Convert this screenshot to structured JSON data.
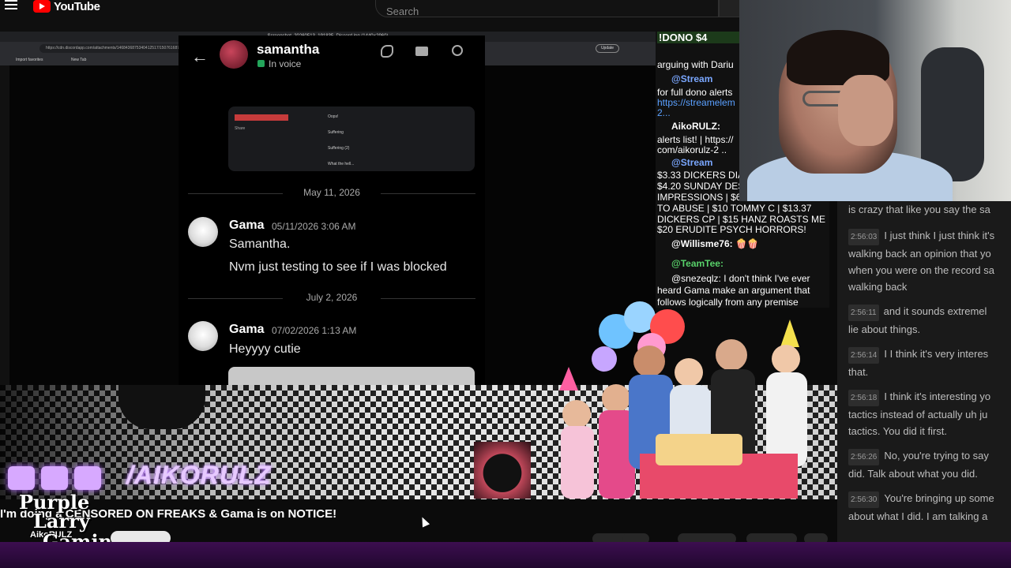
{
  "youtube": {
    "logo_text": "YouTube",
    "search_placeholder": "Search"
  },
  "browser": {
    "title": "Screenshot_20260513_191835_Discord.jpg (1440×2960)",
    "url": "https://cdn.discordapp.com/attachments/1468436875340412517/1507616871335855150/Screenshot_20260513_191835_Discord.jpg?ex=6a0e000b&is=6a0d0e8b&hm=a08d03939f93ddceeb",
    "update_label": "Update",
    "bookmarks": [
      "Import favorites",
      "New Tab"
    ]
  },
  "discord": {
    "contact_name": "samantha",
    "contact_status": "In voice",
    "embed": {
      "share_label": "Share",
      "rows": [
        "Oops!",
        "Suffering",
        "Suffering (2)",
        "What the hell..."
      ]
    },
    "dates": [
      "May 11, 2026",
      "July 2, 2026"
    ],
    "messages": [
      {
        "author": "Gama",
        "time": "05/11/2026 3:06 AM",
        "lines": [
          "Samantha.",
          "Nvm just testing to see if I was blocked"
        ]
      },
      {
        "author": "Gama",
        "time": "07/02/2026 1:13 AM",
        "lines": [
          "Heyyyy cutie"
        ]
      }
    ]
  },
  "overlay": {
    "handle": "/AIKORULZ",
    "stream_title": "I'm doing a CENSORED ON FREAKS & Gama is on NOTICE!",
    "brand": {
      "line1": "Purple",
      "line2": "Larry",
      "line3": "Gaming",
      "small": "AikoRULZ"
    },
    "subscribe_label": ""
  },
  "dono_chat": {
    "banner": "!DONO  $4",
    "lines": [
      {
        "text": "arguing with Dariu",
        "style": "plain"
      },
      {
        "text": "@Stream",
        "style": "blue"
      },
      {
        "text": "for full dono alerts",
        "style": "plain"
      },
      {
        "text": "https://streamelem",
        "style": "link"
      },
      {
        "text": "2...",
        "style": "link"
      },
      {
        "text": "AikoRULZ:",
        "style": "white"
      },
      {
        "text": "alerts list! | https://",
        "style": "plain"
      },
      {
        "text": "com/aikorulz-2 ..",
        "style": "plain"
      },
      {
        "text": "@Stream",
        "style": "blue"
      },
      {
        "text": "$3.33 DICKERS DIA",
        "style": "plain"
      },
      {
        "text": "$4.20 SUNDAY DES",
        "style": "plain"
      },
      {
        "text": "IMPRESSIONS | $6",
        "style": "plain"
      },
      {
        "text": "TO ABUSE | $10 TOMMY C | $13.37",
        "style": "plain"
      },
      {
        "text": "DICKERS CP | $15 HANZ ROASTS ME |",
        "style": "plain"
      },
      {
        "text": "$20 ERUDITE PSYCH HORRORS!",
        "style": "plain"
      },
      {
        "text": "@Willisme76: 🍿🍿",
        "style": "white"
      },
      {
        "text": "@TeamTee:",
        "style": "green"
      },
      {
        "text": "@snezeqlz: I don't think I've ever",
        "style": "plain"
      },
      {
        "text": "heard Gama make an argument that",
        "style": "plain"
      },
      {
        "text": "follows logically from any premise",
        "style": "plain"
      }
    ]
  },
  "transcript": [
    {
      "time": "",
      "lines": [
        "is crazy that like you say the sa"
      ]
    },
    {
      "time": "2:56:03",
      "lines": [
        "I just think I just think it's",
        "walking back an opinion that yo",
        "when you were on the record sa",
        "walking back"
      ]
    },
    {
      "time": "2:56:11",
      "lines": [
        "and it sounds extremel",
        "lie about things."
      ]
    },
    {
      "time": "2:56:14",
      "lines": [
        "I I think it's very interes",
        "that."
      ]
    },
    {
      "time": "2:56:18",
      "lines": [
        "I think it's interesting yo",
        "tactics instead of actually uh ju",
        "tactics. You did it first."
      ]
    },
    {
      "time": "2:56:26",
      "lines": [
        "No, you're trying to say",
        "did. Talk about what you did."
      ]
    },
    {
      "time": "2:56:30",
      "lines": [
        "You're bringing up some",
        "about what I did. I am talking a"
      ]
    }
  ],
  "colors": {
    "youtube_red": "#ff0000",
    "discord_voice_green": "#23a55a",
    "purple_glow": "#b36bff",
    "dono_banner": "#1c3a1a",
    "link_blue": "#5aa0ff"
  }
}
